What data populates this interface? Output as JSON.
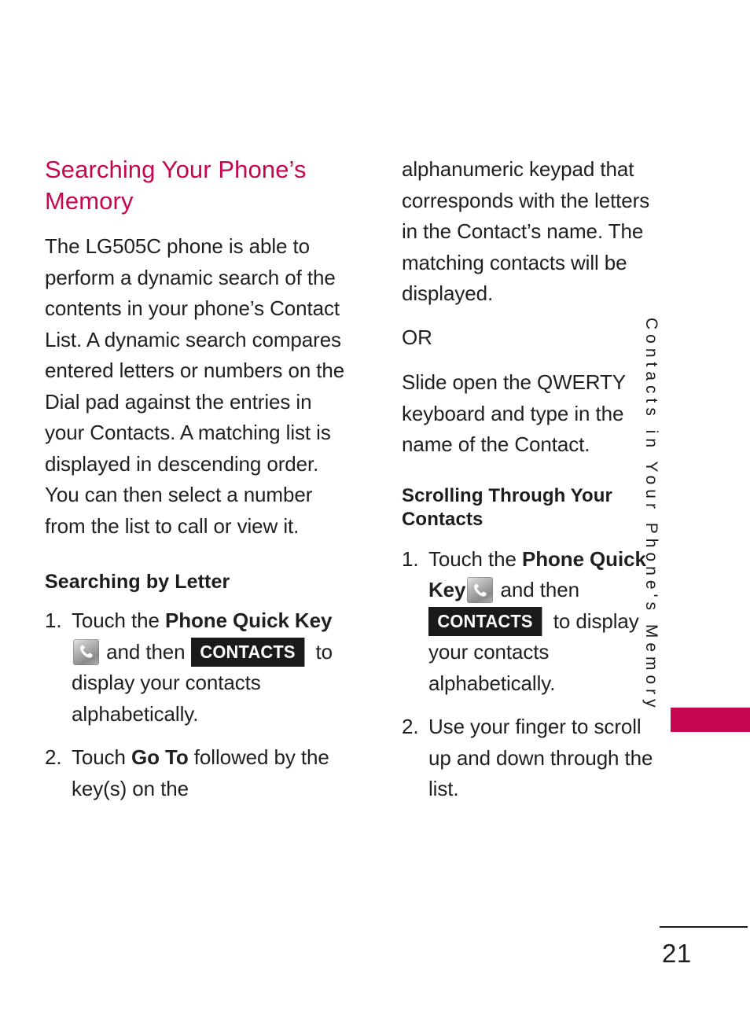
{
  "page": {
    "number": "21",
    "running_head": "Contacts in Your Phone's Memory",
    "accent_color": "#c70651",
    "text_color": "#211f1f",
    "badge_color": "#1a1a1a"
  },
  "left_column": {
    "heading": "Searching Your Phone’s\nMemory",
    "intro_paragraph": "The LG505C phone is able to perform a dynamic search of the contents in your phone’s Contact List. A dynamic search compares entered letters or numbers on the Dial pad against the entries in your Contacts. A matching list is displayed in descending order. You can then select a number from the list to call or view it.",
    "subheading": "Searching by Letter",
    "steps": [
      {
        "num": "1.",
        "text_before_bold": "Touch the ",
        "bold_phrase": "Phone Quick Key",
        "icon": "phone-key-icon",
        "text_after_icon": " and then ",
        "badge": "CONTACTS",
        "text_after_badge": " to display your contacts alphabetically."
      },
      {
        "num": "2.",
        "text_before_bold": "Touch ",
        "bold_phrase": "Go To",
        "text_after_bold": " followed by the key(s) on the"
      }
    ]
  },
  "right_column": {
    "continuation_paragraph": "alphanumeric keypad that corresponds with     the letters in the Contact’s name. The matching contacts will be displayed.",
    "or_label": "OR",
    "qwerty_paragraph": "Slide open the QWERTY keyboard and type in the name of the Contact.",
    "heading": "Scrolling Through Your Contacts",
    "steps": [
      {
        "num": "1.",
        "text_before_bold": "Touch the ",
        "bold_phrase": "Phone Quick Key",
        "icon": "phone-key-icon",
        "text_after_icon": " and then ",
        "badge": "CONTACTS",
        "text_after_badge": " to display your contacts alphabetically."
      },
      {
        "num": "2.",
        "text": "Use your finger to scroll up and down through the list."
      }
    ]
  }
}
